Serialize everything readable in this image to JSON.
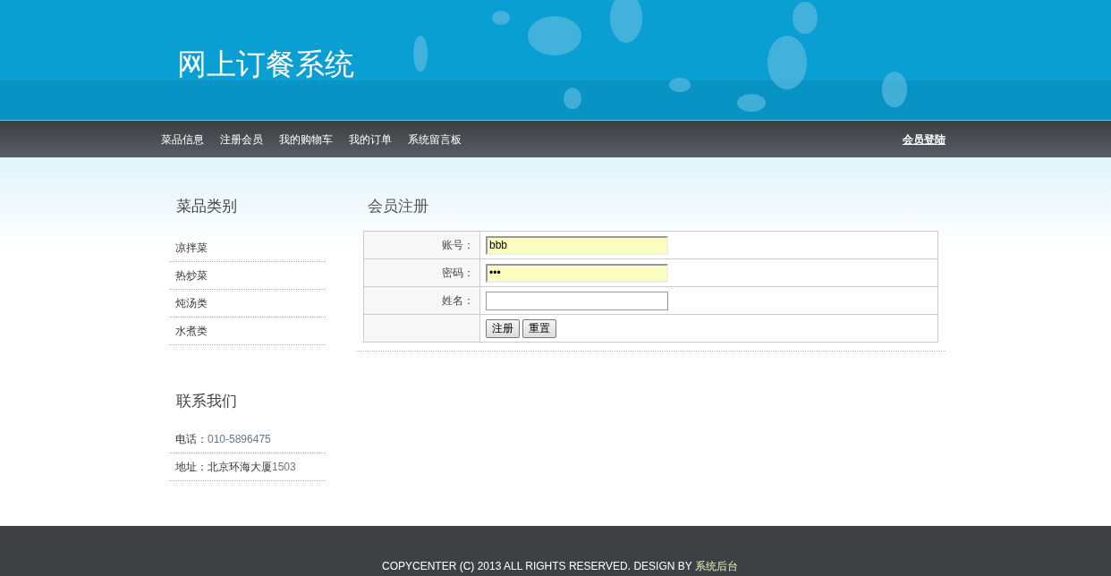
{
  "header": {
    "title": "网上订餐系统"
  },
  "nav": {
    "items": [
      {
        "label": "菜品信息"
      },
      {
        "label": "注册会员"
      },
      {
        "label": "我的购物车"
      },
      {
        "label": "我的订单"
      },
      {
        "label": "系统留言板"
      }
    ],
    "login_link": "会员登陆"
  },
  "sidebar": {
    "categories": {
      "title": "菜品类别",
      "items": [
        "凉拌菜",
        "热炒菜",
        "炖汤类",
        "水煮类"
      ]
    },
    "contact": {
      "title": "联系我们",
      "items": [
        {
          "label": "电话：",
          "value": "010-5896475"
        },
        {
          "label": "地址：北京环海大厦",
          "value": "1503"
        }
      ]
    }
  },
  "form": {
    "title": "会员注册",
    "fields": [
      {
        "label": "账号：",
        "value": "bbb",
        "autofilled": true
      },
      {
        "label": "密码：",
        "value": "•••",
        "autofilled": true
      },
      {
        "label": "姓名：",
        "autofilled": false
      }
    ],
    "buttons": [
      "注册",
      "重置"
    ]
  },
  "footer": {
    "text": "COPYCENTER (C) 2013 ALL RIGHTS RESERVED. DESIGN BY ",
    "link": "系统后台"
  }
}
